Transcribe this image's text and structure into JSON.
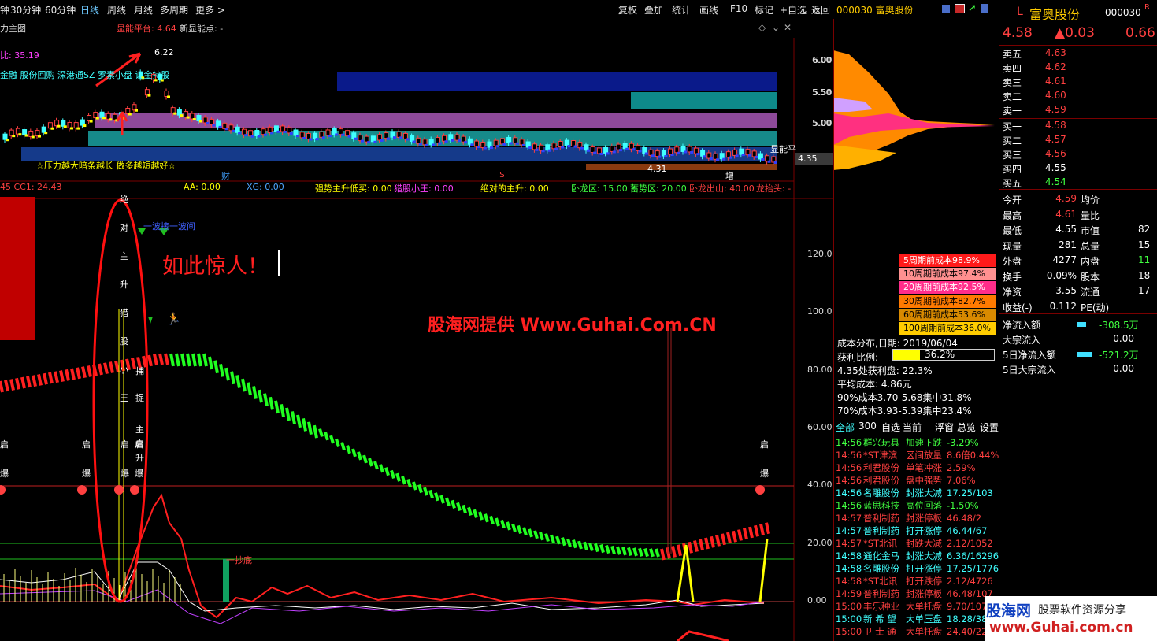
{
  "toolbar": {
    "left_items": [
      "钟",
      "30分钟",
      "60分钟",
      "日线",
      "周线",
      "月线",
      "多周期",
      "更多"
    ],
    "right_items": [
      "复权",
      "叠加",
      "统计",
      "画线",
      "F10",
      "标记",
      "+自选",
      "返回"
    ],
    "stock_tag": "000030 富奥股份"
  },
  "main_chart": {
    "title": "力主图",
    "platform_label": "显能平台: 4.64",
    "new_low_label": "新显能点: -",
    "left_value": "比: 35.19",
    "concepts": "金融 股份回购 深港通SZ 罗素小盘 证金持股",
    "high_label": "6.22",
    "low_label": "4.31",
    "footer_note": "☆压力越大暗条越长 做多越短越好☆",
    "markers": [
      "财",
      "$",
      "增"
    ],
    "right_tag": "显能平",
    "price_tag": "4.35",
    "price_axis": [
      "6.00",
      "5.50",
      "5.00"
    ]
  },
  "indicator": {
    "values": [
      {
        "text": "45 CC1: 24.43",
        "color": "#ff4040"
      },
      {
        "text": "AA: 0.00",
        "color": "#ffff00"
      },
      {
        "text": "XG: 0.00",
        "color": "#4da6ff"
      },
      {
        "text": "强势主升低买: 0.00",
        "color": "#ffff00"
      },
      {
        "text": "猎股小王: 0.00",
        "color": "#ff40ff"
      },
      {
        "text": "绝对的主升: 0.00",
        "color": "#ffff00"
      },
      {
        "text": "卧龙区: 15.00",
        "color": "#40ff40"
      },
      {
        "text": "蓄势区: 20.00",
        "color": "#40ff40"
      },
      {
        "text": "卧龙出山: 40.00",
        "color": "#ff4040"
      },
      {
        "text": "龙抬头: -",
        "color": "#ff4040"
      }
    ],
    "vertical_text_1": [
      "绝",
      "对",
      "主",
      "升",
      "猎",
      "股",
      "小",
      "王"
    ],
    "vertical_text_2": [
      "捕",
      "捉",
      "主",
      "启",
      "升"
    ],
    "annotation": "如此惊人！",
    "watermark": "股海网提供 Www.Guhai.Com.CN",
    "blue_tag": "一波接一波间",
    "bottom_tag": "一抄底",
    "start_labels": [
      "启",
      "爆"
    ],
    "axis": [
      "120.0",
      "100.0",
      "80.00",
      "60.00",
      "40.00",
      "20.00",
      "0.00"
    ]
  },
  "quote": {
    "code": "000030",
    "name": "富奥股份",
    "price": "4.58",
    "change": "▲0.03",
    "pct": "0.66",
    "asks": [
      {
        "label": "卖五",
        "price": "4.63"
      },
      {
        "label": "卖四",
        "price": "4.62"
      },
      {
        "label": "卖三",
        "price": "4.61"
      },
      {
        "label": "卖二",
        "price": "4.60"
      },
      {
        "label": "卖一",
        "price": "4.59"
      }
    ],
    "bids": [
      {
        "label": "买一",
        "price": "4.58"
      },
      {
        "label": "买二",
        "price": "4.57"
      },
      {
        "label": "买三",
        "price": "4.56"
      },
      {
        "label": "买四",
        "price": "4.55"
      },
      {
        "label": "买五",
        "price": "4.54"
      }
    ],
    "stats": [
      {
        "l": "今开",
        "v": "4.59",
        "l2": "均价",
        "v2": ""
      },
      {
        "l": "最高",
        "v": "4.61",
        "l2": "量比",
        "v2": ""
      },
      {
        "l": "最低",
        "v": "4.55",
        "l2": "市值",
        "v2": "82"
      },
      {
        "l": "现量",
        "v": "281",
        "l2": "总量",
        "v2": "15"
      },
      {
        "l": "外盘",
        "v": "4277",
        "l2": "内盘",
        "v2": "11"
      },
      {
        "l": "换手",
        "v": "0.09%",
        "l2": "股本",
        "v2": "18"
      },
      {
        "l": "净资",
        "v": "3.55",
        "l2": "流通",
        "v2": "17"
      },
      {
        "l": "收益(-)",
        "v": "0.112",
        "l2": "PE(动)",
        "v2": ""
      }
    ],
    "flows": [
      {
        "l": "净流入额",
        "v": "-308.5万"
      },
      {
        "l": "大宗流入",
        "v": "0.00"
      },
      {
        "l": "5日净流入额",
        "v": "-521.2万"
      },
      {
        "l": "5日大宗流入",
        "v": "0.00"
      }
    ]
  },
  "cost": {
    "boxes": [
      {
        "text": "5周期前成本98.9%",
        "bg": "#ff1a1a",
        "fg": "#ffffff"
      },
      {
        "text": "10周期前成本97.4%",
        "bg": "#ff9090",
        "fg": "#000000"
      },
      {
        "text": "20周期前成本92.5%",
        "bg": "#ff2d8a",
        "fg": "#ffffff"
      },
      {
        "text": "30周期前成本82.7%",
        "bg": "#ff7a00",
        "fg": "#000000"
      },
      {
        "text": "60周期前成本53.6%",
        "bg": "#d88a00",
        "fg": "#000000"
      },
      {
        "text": "100周期前成本36.0%",
        "bg": "#ffcc00",
        "fg": "#000000"
      }
    ],
    "date_line": "成本分布,日期: 2019/06/04",
    "profit_label": "获利比例:",
    "profit_value": "36.2%",
    "lines": [
      "4.35处获利盘: 22.3%",
      "平均成本: 4.86元",
      "90%成本3.70-5.68集中31.8%",
      "70%成本3.93-5.39集中23.4%"
    ],
    "axis": [
      "6.00",
      "5.50",
      "5.00"
    ]
  },
  "news": {
    "tabs": [
      "全部",
      "300",
      "自选",
      "当前",
      "浮窗",
      "总览",
      "设置"
    ],
    "rows": [
      {
        "t": "14:56",
        "n": "群兴玩具",
        "e": "加速下跌",
        "v": "-3.29%",
        "c": "#40ff40"
      },
      {
        "t": "14:56",
        "n": "*ST津滨",
        "e": "区间放量",
        "v": "8.6倍0.44%",
        "c": "#ff4040"
      },
      {
        "t": "14:56",
        "n": "利君股份",
        "e": "单笔冲涨",
        "v": "2.59%",
        "c": "#ff4040"
      },
      {
        "t": "14:56",
        "n": "利君股份",
        "e": "盘中强势",
        "v": "7.06%",
        "c": "#ff4040"
      },
      {
        "t": "14:56",
        "n": "名雕股份",
        "e": "封涨大减",
        "v": "17.25/103",
        "c": "#40ffff"
      },
      {
        "t": "14:56",
        "n": "蓝思科技",
        "e": "高位回落",
        "v": "-1.50%",
        "c": "#40ff40"
      },
      {
        "t": "14:57",
        "n": "普利制药",
        "e": "封涨停板",
        "v": "46.48/2",
        "c": "#ff4040"
      },
      {
        "t": "14:57",
        "n": "普利制药",
        "e": "打开涨停",
        "v": "46.44/67",
        "c": "#40ffff"
      },
      {
        "t": "14:57",
        "n": "*ST北讯",
        "e": "封跌大减",
        "v": "2.12/1052",
        "c": "#ff4040"
      },
      {
        "t": "14:58",
        "n": "通化金马",
        "e": "封涨大减",
        "v": "6.36/16296",
        "c": "#40ffff"
      },
      {
        "t": "14:58",
        "n": "名雕股份",
        "e": "打开涨停",
        "v": "17.25/1776",
        "c": "#40ffff"
      },
      {
        "t": "14:58",
        "n": "*ST北讯",
        "e": "打开跌停",
        "v": "2.12/4726",
        "c": "#ff4040"
      },
      {
        "t": "14:59",
        "n": "普利制药",
        "e": "封涨停板",
        "v": "46.48/107",
        "c": "#ff4040"
      },
      {
        "t": "15:00",
        "n": "丰乐种业",
        "e": "大单托盘",
        "v": "9.70/107",
        "c": "#ff4040"
      },
      {
        "t": "15:00",
        "n": "新 希 望",
        "e": "大单压盘",
        "v": "18.28/38",
        "c": "#40ffff"
      },
      {
        "t": "15:00",
        "n": "卫 士 通",
        "e": "大单托盘",
        "v": "24.40/22",
        "c": "#ff4040"
      }
    ]
  },
  "logo": {
    "brand": "股海网",
    "slogan": "股票软件资源分享",
    "url": "www.Guhai.com.cn"
  }
}
